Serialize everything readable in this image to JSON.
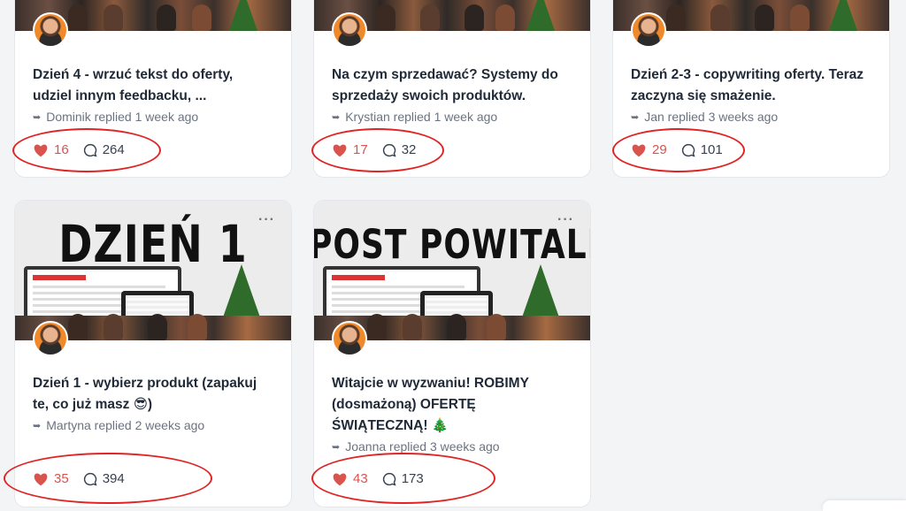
{
  "posts": [
    {
      "title": "Dzień 4 - wrzuć tekst do oferty, udziel innym feedbacku, ...",
      "replied": "Dominik replied 1 week ago",
      "likes": "16",
      "comments": "264"
    },
    {
      "title": "Na czym sprzedawać? Systemy do sprzedaży swoich produktów.",
      "replied": "Krystian replied 1 week ago",
      "likes": "17",
      "comments": "32"
    },
    {
      "title": "Dzień 2-3 - copywriting oferty. Teraz zaczyna się smażenie.",
      "replied": "Jan replied 3 weeks ago",
      "likes": "29",
      "comments": "101"
    },
    {
      "cover_text": "DZIEŃ 1",
      "more": "···",
      "title": "Dzień 1 - wybierz produkt (zapakuj te, co już masz 😎)",
      "replied": "Martyna replied 2 weeks ago",
      "likes": "35",
      "comments": "394"
    },
    {
      "cover_text": "POST POWITALNY!",
      "more": "···",
      "title": "Witajcie w wyzwaniu! ROBIMY (dosmażoną) OFERTĘ ŚWIĄTECZNĄ! 🎄",
      "replied": "Joanna replied 3 weeks ago",
      "likes": "43",
      "comments": "173"
    }
  ],
  "icons": {
    "reply": "reply-arrow-icon",
    "like": "heart-icon",
    "comment": "comment-bubble-icon",
    "more": "more-dots-icon"
  },
  "colors": {
    "like": "#d9534f",
    "annotation_oval": "#e02424",
    "cover_tree": "#2f6b2a",
    "avatar_bg": "#f0892a"
  }
}
